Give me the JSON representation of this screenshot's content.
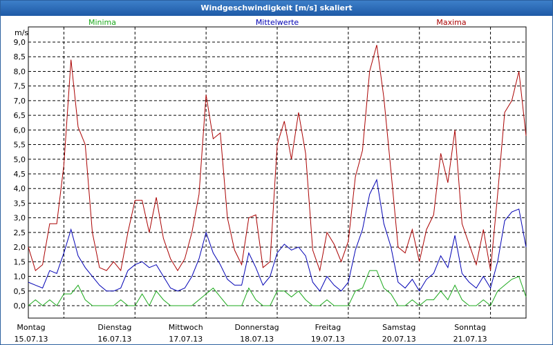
{
  "window": {
    "title": "Windgeschwindigkeit [m/s] skaliert"
  },
  "legend": [
    {
      "label": "Minima",
      "color": "#1aa81a"
    },
    {
      "label": "Mittelwerte",
      "color": "#0000b4"
    },
    {
      "label": "Maxima",
      "color": "#aa0000"
    }
  ],
  "chart_data": {
    "type": "line",
    "title": "Windgeschwindigkeit [m/s] skaliert",
    "ylabel": "m/s",
    "ylim": [
      0,
      9
    ],
    "yticks": [
      "0,0",
      "0,5",
      "1,0",
      "1,5",
      "2,0",
      "2,5",
      "3,0",
      "3,5",
      "4,0",
      "4,5",
      "5,0",
      "5,5",
      "6,0",
      "6,5",
      "7,0",
      "7,5",
      "8,0",
      "8,5",
      "9,0"
    ],
    "xlim": [
      0,
      7
    ],
    "grid": true,
    "legend_position": "top",
    "days": [
      {
        "name": "Montag",
        "date": "15.07.13"
      },
      {
        "name": "Dienstag",
        "date": "16.07.13"
      },
      {
        "name": "Mittwoch",
        "date": "17.07.13"
      },
      {
        "name": "Donnerstag",
        "date": "18.07.13"
      },
      {
        "name": "Freitag",
        "date": "19.07.13"
      },
      {
        "name": "Samstag",
        "date": "20.07.13"
      },
      {
        "name": "Sonntag",
        "date": "21.07.13"
      }
    ],
    "x": [
      0.0,
      0.1,
      0.2,
      0.3,
      0.4,
      0.5,
      0.6,
      0.7,
      0.8,
      0.9,
      1.0,
      1.1,
      1.2,
      1.3,
      1.4,
      1.5,
      1.6,
      1.7,
      1.8,
      1.9,
      2.0,
      2.1,
      2.2,
      2.3,
      2.4,
      2.5,
      2.6,
      2.7,
      2.8,
      2.9,
      3.0,
      3.1,
      3.2,
      3.3,
      3.4,
      3.5,
      3.6,
      3.7,
      3.8,
      3.9,
      4.0,
      4.1,
      4.2,
      4.3,
      4.4,
      4.5,
      4.6,
      4.7,
      4.8,
      4.9,
      5.0,
      5.1,
      5.2,
      5.3,
      5.4,
      5.5,
      5.6,
      5.7,
      5.8,
      5.9,
      6.0,
      6.1,
      6.2,
      6.3,
      6.4,
      6.5,
      6.6,
      6.7,
      6.8,
      6.9,
      7.0
    ],
    "series": [
      {
        "name": "Maxima",
        "color": "#aa0000",
        "values": [
          2.0,
          1.2,
          1.4,
          2.8,
          2.8,
          4.8,
          8.4,
          6.1,
          5.5,
          2.5,
          1.3,
          1.2,
          1.5,
          1.2,
          2.5,
          3.6,
          3.6,
          2.5,
          3.7,
          2.3,
          1.6,
          1.2,
          1.6,
          2.5,
          3.8,
          7.2,
          5.7,
          5.9,
          3.0,
          1.9,
          1.4,
          3.0,
          3.1,
          1.3,
          1.5,
          5.5,
          6.3,
          5.0,
          6.6,
          5.2,
          1.9,
          1.2,
          2.5,
          2.1,
          1.5,
          2.2,
          4.4,
          5.3,
          8.0,
          8.9,
          7.1,
          4.6,
          2.0,
          1.8,
          2.6,
          1.5,
          2.6,
          3.1,
          5.2,
          4.2,
          6.0,
          2.8,
          2.1,
          1.4,
          2.6,
          1.2,
          3.8,
          6.6,
          7.0,
          8.0,
          5.8,
          1.5
        ]
      },
      {
        "name": "Mittelwerte",
        "color": "#0000b4",
        "values": [
          0.8,
          0.7,
          0.6,
          1.2,
          1.1,
          1.8,
          2.6,
          1.7,
          1.3,
          1.0,
          0.7,
          0.5,
          0.5,
          0.6,
          1.2,
          1.4,
          1.5,
          1.3,
          1.4,
          1.0,
          0.6,
          0.5,
          0.6,
          1.0,
          1.6,
          2.5,
          1.8,
          1.4,
          0.9,
          0.7,
          0.7,
          1.8,
          1.3,
          0.7,
          1.0,
          1.8,
          2.1,
          1.9,
          2.0,
          1.7,
          0.8,
          0.5,
          1.0,
          0.7,
          0.5,
          0.8,
          1.9,
          2.6,
          3.8,
          4.3,
          2.8,
          2.0,
          0.8,
          0.6,
          0.9,
          0.5,
          0.9,
          1.1,
          1.7,
          1.3,
          2.4,
          1.1,
          0.8,
          0.6,
          1.0,
          0.6,
          1.5,
          2.9,
          3.2,
          3.3,
          2.0,
          0.6
        ]
      },
      {
        "name": "Minima",
        "color": "#1aa81a",
        "values": [
          0.0,
          0.2,
          0.0,
          0.2,
          0.0,
          0.4,
          0.4,
          0.7,
          0.2,
          0.0,
          0.0,
          0.0,
          0.0,
          0.2,
          0.0,
          0.0,
          0.4,
          0.0,
          0.5,
          0.2,
          0.0,
          0.0,
          0.0,
          0.0,
          0.2,
          0.4,
          0.6,
          0.3,
          0.0,
          0.0,
          0.0,
          0.6,
          0.2,
          0.0,
          0.0,
          0.5,
          0.5,
          0.3,
          0.5,
          0.2,
          0.0,
          0.0,
          0.2,
          0.0,
          0.0,
          0.0,
          0.5,
          0.6,
          1.2,
          1.2,
          0.6,
          0.4,
          0.0,
          0.0,
          0.2,
          0.0,
          0.2,
          0.2,
          0.5,
          0.2,
          0.7,
          0.2,
          0.0,
          0.0,
          0.2,
          0.0,
          0.5,
          0.7,
          0.9,
          1.0,
          0.3,
          0.0
        ]
      }
    ]
  }
}
